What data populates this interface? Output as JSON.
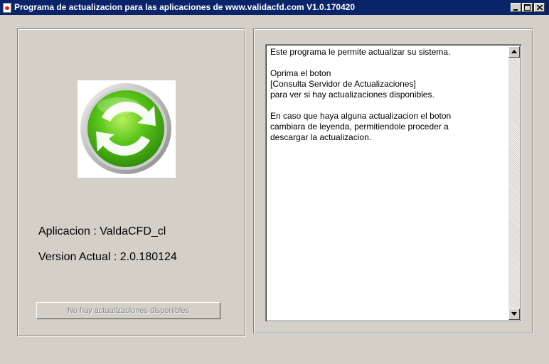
{
  "window": {
    "title": "Programa de actualizacion para las aplicaciones de www.validacfd.com V1.0.170420"
  },
  "app_info": {
    "application": "Aplicacion : ValdaCFD_cl",
    "version": "Version Actual : 2.0.180124"
  },
  "update_button": {
    "label": "No hay actualizaciones disponibles",
    "enabled": false
  },
  "message": {
    "lines": [
      "Este programa le permite actualizar su sistema.",
      "",
      "Oprima el boton",
      "[Consulta Servidor de Actualizaciones]",
      "para ver si hay actualizaciones disponibles.",
      "",
      "En caso que haya alguna actualizacion el boton",
      "cambiara de leyenda, permitiendole proceder a",
      "descargar la actualizacion."
    ]
  },
  "icons": {
    "app_icon": "app-icon",
    "logo": "refresh-arrows-logo",
    "logo_color": "#5cc71a"
  },
  "colors": {
    "titlebar": "#0a246a",
    "face": "#d4d0c8"
  }
}
